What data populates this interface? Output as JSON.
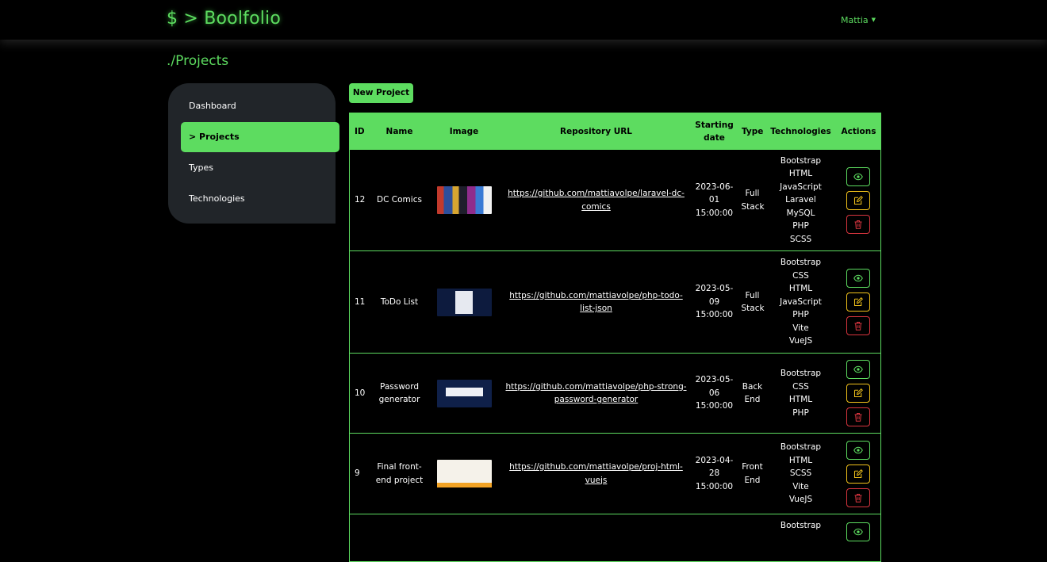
{
  "navbar": {
    "brand": "$ > Boolfolio",
    "user": "Mattia"
  },
  "page": {
    "title": "./Projects"
  },
  "sidebar": {
    "items": [
      {
        "label": "Dashboard"
      },
      {
        "label": "> Projects"
      },
      {
        "label": "Types"
      },
      {
        "label": "Technologies"
      }
    ]
  },
  "toolbar": {
    "new_project": "New Project"
  },
  "table": {
    "headers": [
      "ID",
      "Name",
      "Image",
      "Repository URL",
      "Starting date",
      "Type",
      "Technologies",
      "Actions"
    ],
    "rows": [
      {
        "id": "12",
        "name": "DC Comics",
        "url": "https://github.com/mattiavolpe/laravel-dc-comics",
        "date": "2023-06-01 15:00:00",
        "type": "Full Stack",
        "techs": [
          "Bootstrap",
          "HTML",
          "JavaScript",
          "Laravel",
          "MySQL",
          "PHP",
          "SCSS"
        ]
      },
      {
        "id": "11",
        "name": "ToDo List",
        "url": "https://github.com/mattiavolpe/php-todo-list-json",
        "date": "2023-05-09 15:00:00",
        "type": "Full Stack",
        "techs": [
          "Bootstrap",
          "CSS",
          "HTML",
          "JavaScript",
          "PHP",
          "Vite",
          "VueJS"
        ]
      },
      {
        "id": "10",
        "name": "Password generator",
        "url": "https://github.com/mattiavolpe/php-strong-password-generator",
        "date": "2023-05-06 15:00:00",
        "type": "Back End",
        "techs": [
          "Bootstrap",
          "CSS",
          "HTML",
          "PHP"
        ]
      },
      {
        "id": "9",
        "name": "Final front-end project",
        "url": "https://github.com/mattiavolpe/proj-html-vuejs",
        "date": "2023-04-28 15:00:00",
        "type": "Front End",
        "techs": [
          "Bootstrap",
          "HTML",
          "SCSS",
          "Vite",
          "VueJS"
        ]
      },
      {
        "id": "",
        "name": "",
        "url": "",
        "date": "",
        "type": "",
        "techs": [
          "Bootstrap"
        ]
      }
    ]
  },
  "icons": {
    "view": "eye-icon",
    "edit": "pencil-square-icon",
    "delete": "trash-icon"
  },
  "colors": {
    "accent": "#5ddc60",
    "edit": "#f2c21b",
    "delete": "#d9353f",
    "panel": "#212529"
  }
}
